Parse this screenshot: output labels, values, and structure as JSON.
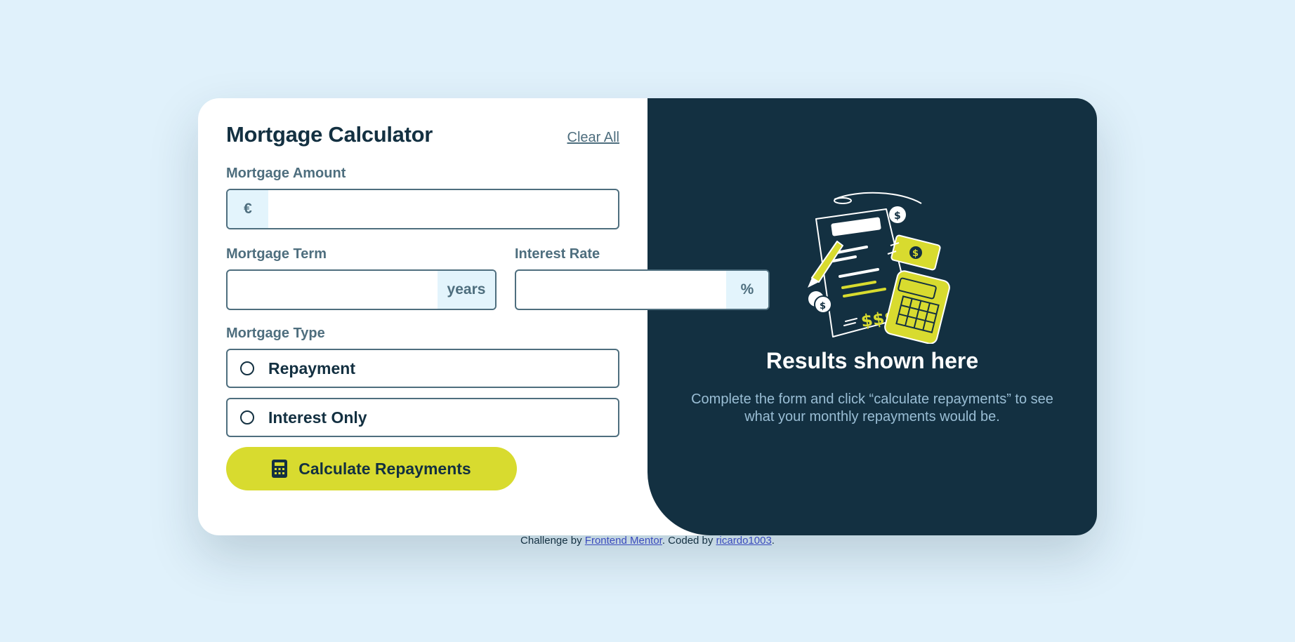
{
  "form": {
    "title": "Mortgage Calculator",
    "clear_all": "Clear All",
    "amount": {
      "label": "Mortgage Amount",
      "prefix": "€",
      "value": ""
    },
    "term": {
      "label": "Mortgage Term",
      "suffix": "years",
      "value": ""
    },
    "rate": {
      "label": "Interest Rate",
      "suffix": "%",
      "value": ""
    },
    "type": {
      "label": "Mortgage Type",
      "options": [
        "Repayment",
        "Interest Only"
      ]
    },
    "submit_label": "Calculate Repayments"
  },
  "results": {
    "title": "Results shown here",
    "description": "Complete the form and click “calculate repayments” to see what your monthly repayments would be."
  },
  "footer": {
    "prefix": "Challenge by",
    "link1": "Frontend Mentor",
    "middle": ". Coded by",
    "link2": "ricardo1003",
    "suffix": "."
  },
  "colors": {
    "background": "#e0f1fb",
    "dark": "#133041",
    "slate": "#4e6e7e",
    "lime": "#d8db2f"
  }
}
